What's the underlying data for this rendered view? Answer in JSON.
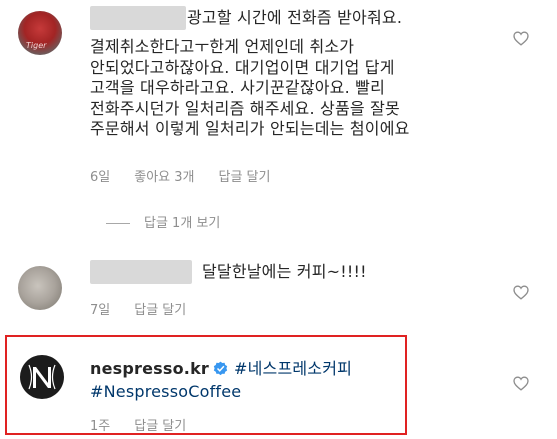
{
  "comments": [
    {
      "text_line1": "광고할 시간에 전화즘 받아줘요.",
      "text_rest": "결제취소한다고ㅜ한게 언제인데 취소가\n안되었다고하잖아요. 대기업이면 대기업 답게\n고객을 대우하라고요. 사기꾼같잖아요. 빨리\n전화주시던가 일처리즘 해주세요. 상품을 잘못\n주문해서 이렇게 일처리가 안되는데는 첨이에요",
      "time": "6일",
      "likes": "좋아요 3개",
      "reply": "답글 달기",
      "view_replies": "답글 1개 보기"
    },
    {
      "text": "달달한날에는 커피~!!!!",
      "time": "7일",
      "reply": "답글 달기"
    },
    {
      "username": "nespresso.kr",
      "hashtag1": "#네스프레소커피",
      "hashtag2": "#NespressoCoffee",
      "time": "1주",
      "reply": "답글 달기",
      "avatar_letter": "N"
    }
  ],
  "icons": {
    "like": "heart-outline-icon",
    "verified": "verified-badge-icon"
  },
  "colors": {
    "meta_gray": "#8e8e8e",
    "hashtag_blue": "#00376b",
    "verified_blue": "#3897f0",
    "highlight_red": "#e02222"
  }
}
